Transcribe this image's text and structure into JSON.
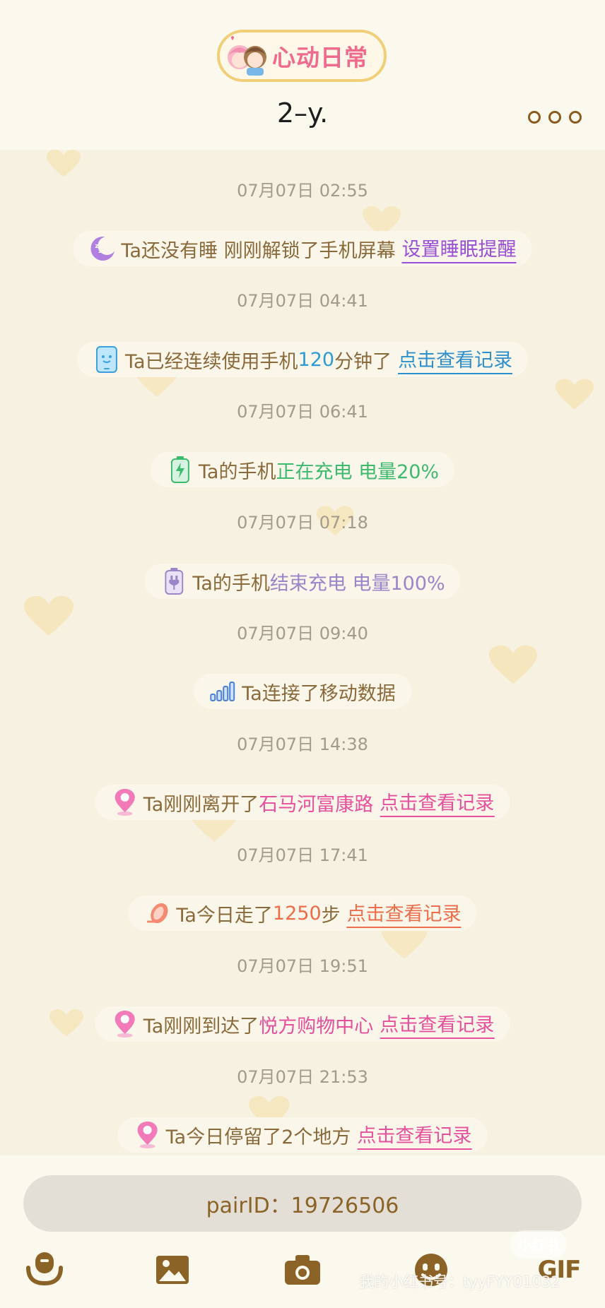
{
  "header": {
    "logo_text": "心动日常",
    "title": "2–y."
  },
  "feed": [
    {
      "time": "07月07日 02:55",
      "icon": "sleep-moon-icon",
      "parts": [
        {
          "text": "Ta还没有睡 刚刚解锁了手机屏幕",
          "color": "#8a6a3a"
        }
      ],
      "link": "设置睡眠提醒",
      "link_color": "#9a4fd6"
    },
    {
      "time": "07月07日 04:41",
      "icon": "phone-icon",
      "parts": [
        {
          "text": "Ta已经连续使用手机",
          "color": "#8a6a3a"
        },
        {
          "text": "120",
          "color": "#2e9bd6"
        },
        {
          "text": "分钟了",
          "color": "#8a6a3a"
        }
      ],
      "link": "点击查看记录",
      "link_color": "#2e8fcb"
    },
    {
      "time": "07月07日 06:41",
      "icon": "battery-charging-icon",
      "parts": [
        {
          "text": "Ta的手机",
          "color": "#8a6a3a"
        },
        {
          "text": "正在充电 电量20%",
          "color": "#3cba6e"
        }
      ],
      "link": "",
      "link_color": ""
    },
    {
      "time": "07月07日 07:18",
      "icon": "battery-plug-icon",
      "parts": [
        {
          "text": "Ta的手机",
          "color": "#8a6a3a"
        },
        {
          "text": "结束充电 电量100%",
          "color": "#9a85c8"
        }
      ],
      "link": "",
      "link_color": ""
    },
    {
      "time": "07月07日 09:40",
      "icon": "signal-bars-icon",
      "parts": [
        {
          "text": "Ta连接了移动数据",
          "color": "#8a6a3a"
        }
      ],
      "link": "",
      "link_color": ""
    },
    {
      "time": "07月07日 14:38",
      "icon": "location-pin-icon",
      "parts": [
        {
          "text": "Ta刚刚离开了",
          "color": "#8a6a3a"
        },
        {
          "text": "石马河富康路",
          "color": "#e6509c"
        }
      ],
      "link": "点击查看记录",
      "link_color": "#e6509c"
    },
    {
      "time": "07月07日 17:41",
      "icon": "footprint-icon",
      "parts": [
        {
          "text": "Ta今日走了 ",
          "color": "#8a6a3a"
        },
        {
          "text": "1250",
          "color": "#ec6d4a"
        },
        {
          "text": " 步",
          "color": "#8a6a3a"
        }
      ],
      "link": "点击查看记录",
      "link_color": "#ec6d4a"
    },
    {
      "time": "07月07日 19:51",
      "icon": "location-pin-icon",
      "parts": [
        {
          "text": "Ta刚刚到达了",
          "color": "#8a6a3a"
        },
        {
          "text": "悦方购物中心",
          "color": "#e6509c"
        }
      ],
      "link": "点击查看记录",
      "link_color": "#e6509c"
    },
    {
      "time": "07月07日 21:53",
      "icon": "location-pin-icon",
      "parts": [
        {
          "text": "Ta今日停留了2个地方",
          "color": "#8a6a3a"
        }
      ],
      "link": "点击查看记录",
      "link_color": "#e6509c"
    }
  ],
  "input": {
    "text": "pairID：19726506"
  },
  "toolbar": [
    "voice-icon",
    "image-icon",
    "camera-icon",
    "emoji-icon",
    "gif-icon"
  ],
  "toolbar_gif": "GIF",
  "watermark": {
    "badge": "小红书",
    "text": "我的小红书号：tyyFYY01032"
  }
}
